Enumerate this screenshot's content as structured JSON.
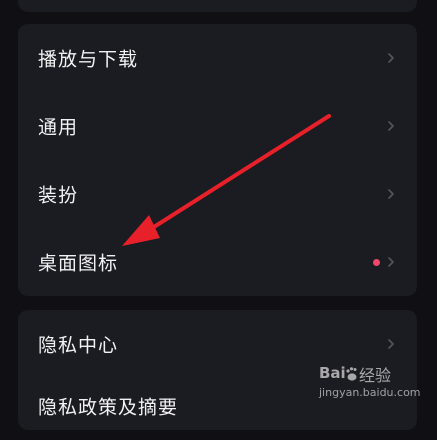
{
  "settings": {
    "group1": [
      {
        "label": "播放与下载",
        "has_dot": false
      },
      {
        "label": "通用",
        "has_dot": false
      },
      {
        "label": "装扮",
        "has_dot": false
      },
      {
        "label": "桌面图标",
        "has_dot": true
      }
    ],
    "group2": [
      {
        "label": "隐私中心"
      },
      {
        "label": "隐私政策及摘要"
      }
    ]
  },
  "colors": {
    "background": "#0f0f14",
    "card": "#1b1b22",
    "chevron": "#55555c",
    "dot": "#f2476c",
    "arrow": "#e8202a"
  },
  "icons": {
    "chevron": "chevron-right-icon",
    "dot": "notification-dot"
  },
  "watermark": {
    "brand": "Baidu经验",
    "text": "经验",
    "url": "jingyan.baidu.com"
  }
}
